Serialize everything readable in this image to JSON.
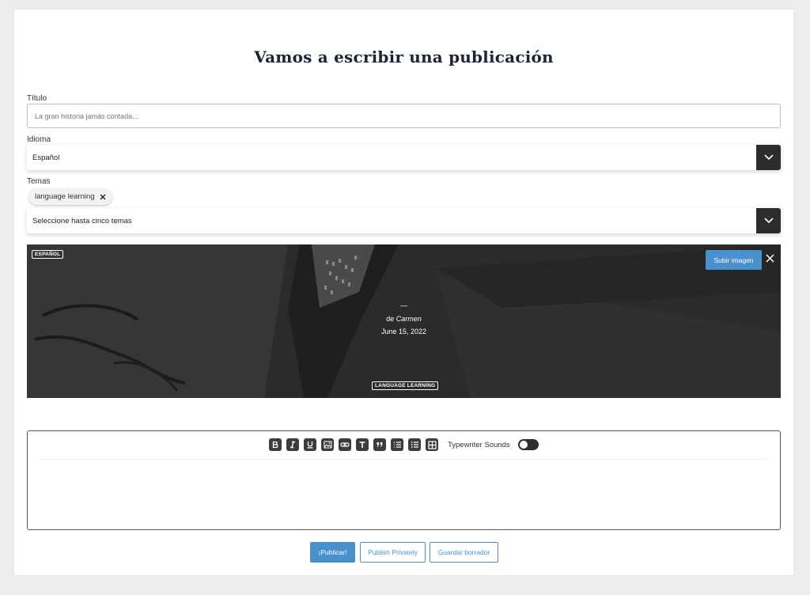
{
  "page_title": "Vamos a escribir una publicación",
  "titulo": {
    "label": "Título",
    "placeholder": "La gran historia jamás contada..."
  },
  "idioma": {
    "label": "Idioma",
    "selected": "Español"
  },
  "temas": {
    "label": "Temas",
    "tags": [
      "language learning"
    ],
    "placeholder": "Seleccione hasta cinco temas"
  },
  "cover": {
    "language_badge": "ESPAÑOL",
    "upload_label": "Subir imagen",
    "dash": "—",
    "by_prefix": "de",
    "author": "Carmen",
    "date": "June 15, 2022",
    "topic_badge": "LANGUAGE LEARNING"
  },
  "editor": {
    "tools": [
      "bold-icon",
      "italic-icon",
      "underline-icon",
      "image-icon",
      "link-icon",
      "text-heading-icon",
      "quote-icon",
      "ordered-list-icon",
      "bulleted-list-icon",
      "table-icon"
    ],
    "typewriter_label": "Typewriter Sounds",
    "typewriter_on": false
  },
  "actions": {
    "publish": "¡Publicar!",
    "publish_private": "Publish Privately",
    "save_draft": "Guardar borrador"
  },
  "colors": {
    "accent": "#4a90cc",
    "dark_button": "#2f2d2c",
    "background": "#ececec"
  }
}
